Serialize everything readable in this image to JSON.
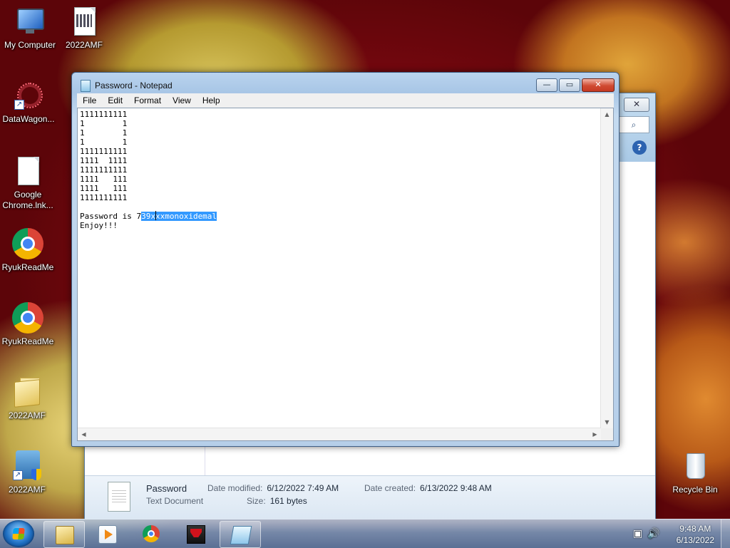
{
  "desktop": {
    "icons": [
      {
        "label": "My Computer"
      },
      {
        "label": "2022AMF"
      },
      {
        "label": "DataWagon..."
      },
      {
        "label": "Google Chrome.lnk..."
      },
      {
        "label": "RyukReadMe"
      },
      {
        "label": "RyukReadMe"
      },
      {
        "label": "2022AMF"
      },
      {
        "label": "2022AMF"
      },
      {
        "label": "Recycle Bin"
      }
    ]
  },
  "explorer": {
    "close_glyph": "✕",
    "search_glyph": "⌕",
    "help_glyph": "?",
    "details": {
      "name": "Password",
      "type": "Text Document",
      "date_modified_label": "Date modified:",
      "date_modified": "6/12/2022 7:49 AM",
      "date_created_label": "Date created:",
      "date_created": "6/13/2022 9:48 AM",
      "size_label": "Size:",
      "size": "161 bytes"
    }
  },
  "notepad": {
    "title": "Password - Notepad",
    "menu": [
      "File",
      "Edit",
      "Format",
      "View",
      "Help"
    ],
    "buttons": {
      "minimize": "—",
      "maximize": "▭",
      "close": "✕"
    },
    "text_art": "1111111111\n1        1\n1        1\n1        1\n1111111111\n1111  1111\n1111111111\n1111   111\n1111   111\n1111111111\n",
    "line_prefix": "Password is 7",
    "selected_text": "39xxxmonoxidemal",
    "line_last": "Enjoy!!!"
  },
  "taskbar": {
    "clock_time": "9:48 AM",
    "clock_date": "6/13/2022"
  }
}
